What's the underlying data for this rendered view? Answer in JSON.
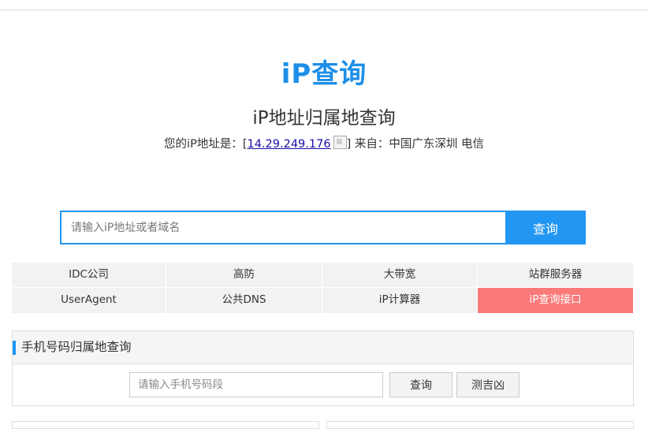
{
  "logo": {
    "text": "iP查询",
    "color": "#1d8fe8"
  },
  "page_title": "iP地址归属地查询",
  "ip_info": {
    "prefix": "您的iP地址是：[",
    "ip": "14.29.249.176",
    "suffix": "] 来自：中国广东深圳 电信"
  },
  "search": {
    "placeholder": "请输入iP地址或者域名",
    "value": "",
    "button_label": "查询",
    "accent": "#2196f3"
  },
  "nav": {
    "items": [
      {
        "label": "IDC公司",
        "highlight": false
      },
      {
        "label": "高防",
        "highlight": false
      },
      {
        "label": "大带宽",
        "highlight": false
      },
      {
        "label": "站群服务器",
        "highlight": false
      },
      {
        "label": "UserAgent",
        "highlight": false
      },
      {
        "label": "公共DNS",
        "highlight": false
      },
      {
        "label": "iP计算器",
        "highlight": false
      },
      {
        "label": "iP查询接口",
        "highlight": true
      }
    ],
    "highlight_color": "#fa7a7a"
  },
  "phone_panel": {
    "title": "手机号码归属地查询",
    "input_placeholder": "请输入手机号码段",
    "query_label": "查询",
    "luck_label": "测吉凶"
  }
}
